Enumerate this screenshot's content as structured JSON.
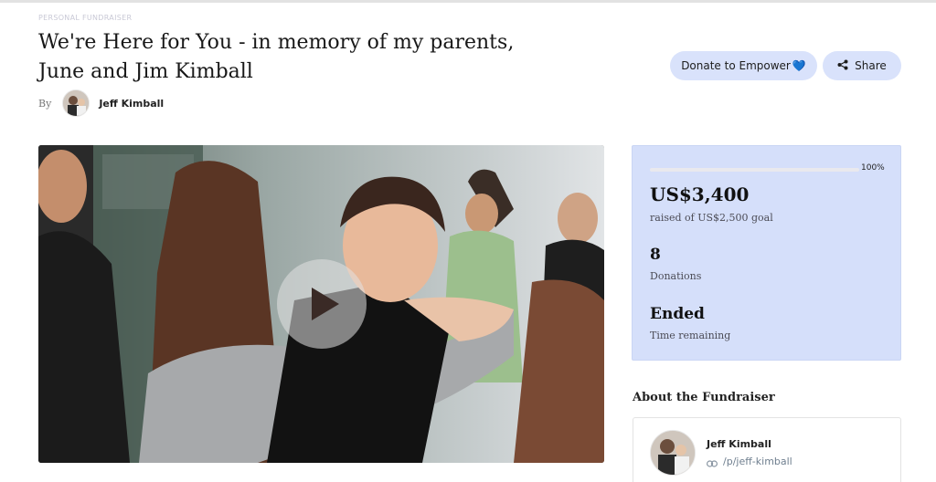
{
  "header": {
    "eyebrow": "PERSONAL FUNDRAISER",
    "title_line1": "We're Here for You - in memory of my parents,",
    "title_line2": "June and Jim Kimball",
    "by_label": "By",
    "author": "Jeff Kimball"
  },
  "actions": {
    "donate_label": "Donate to Empower",
    "donate_emoji": "💙",
    "share_label": "Share"
  },
  "media": {
    "play_icon": "play-icon"
  },
  "stats": {
    "progress_fraction": 1.0,
    "progress_label": "100%",
    "amount": "US$3,400",
    "amount_sub": "raised of US$2,500 goal",
    "donations": "8",
    "donations_label": "Donations",
    "status": "Ended",
    "status_label": "Time remaining"
  },
  "about": {
    "heading": "About the Fundraiser",
    "name": "Jeff Kimball",
    "link": "/p/jeff-kimball"
  },
  "colors": {
    "accent_bg": "#d5dffa",
    "button_bg": "#d9e2fb"
  }
}
